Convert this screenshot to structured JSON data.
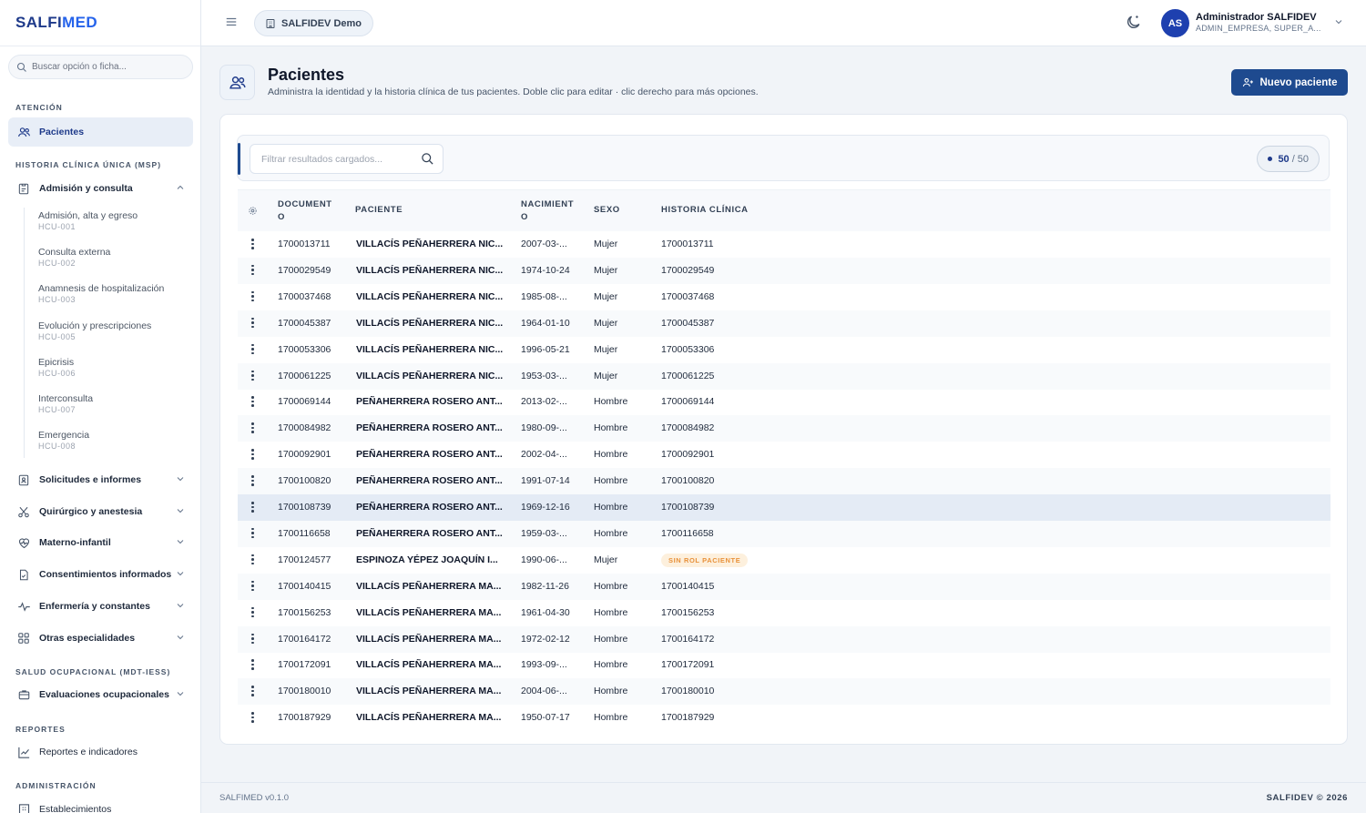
{
  "brand": {
    "part1": "SALFI",
    "part2": "MED"
  },
  "sidebar": {
    "search_placeholder": "Buscar opción o ficha...",
    "section_atencion": "ATENCIÓN",
    "pacientes": "Pacientes",
    "section_hcu": "HISTORIA CLÍNICA ÚNICA (MSP)",
    "admision": "Admisión y consulta",
    "subitems": [
      {
        "title": "Admisión, alta y egreso",
        "code": "HCU-001"
      },
      {
        "title": "Consulta externa",
        "code": "HCU-002"
      },
      {
        "title": "Anamnesis de hospitalización",
        "code": "HCU-003"
      },
      {
        "title": "Evolución y prescripciones",
        "code": "HCU-005"
      },
      {
        "title": "Epicrisis",
        "code": "HCU-006"
      },
      {
        "title": "Interconsulta",
        "code": "HCU-007"
      },
      {
        "title": "Emergencia",
        "code": "HCU-008"
      }
    ],
    "solicitudes": "Solicitudes e informes",
    "quirurgico": "Quirúrgico y anestesia",
    "materno": "Materno-infantil",
    "consentimientos": "Consentimientos informados",
    "enfermeria": "Enfermería y constantes",
    "otras": "Otras especialidades",
    "section_salud": "SALUD OCUPACIONAL (MDT-IESS)",
    "evaluaciones": "Evaluaciones ocupacionales",
    "section_reportes": "REPORTES",
    "reportes": "Reportes e indicadores",
    "section_admin": "ADMINISTRACIÓN",
    "establecimientos": "Establecimientos"
  },
  "topbar": {
    "org": "SALFIDEV Demo",
    "avatar": "AS",
    "user_name": "Administrador SALFIDEV",
    "user_role": "ADMIN_EMPRESA, SUPER_A..."
  },
  "page": {
    "title": "Pacientes",
    "subtitle": "Administra la identidad y la historia clínica de tus pacientes. Doble clic para editar · clic derecho para más opciones.",
    "new_button": "Nuevo paciente"
  },
  "filter": {
    "placeholder": "Filtrar resultados cargados...",
    "count_loaded": "50",
    "count_sep": "/",
    "count_total": "50"
  },
  "table": {
    "headers": {
      "doc1": "DOCUMENT",
      "doc2": "O",
      "paciente": "PACIENTE",
      "nac1": "NACIMIENT",
      "nac2": "O",
      "sexo": "SEXO",
      "historia": "HISTORIA CLÍNICA"
    },
    "rows": [
      {
        "doc": "1700013711",
        "paciente": "VILLACÍS PEÑAHERRERA NIC...",
        "nac": "2007-03-...",
        "sexo": "Mujer",
        "hc": "1700013711"
      },
      {
        "doc": "1700029549",
        "paciente": "VILLACÍS PEÑAHERRERA NIC...",
        "nac": "1974-10-24",
        "sexo": "Mujer",
        "hc": "1700029549"
      },
      {
        "doc": "1700037468",
        "paciente": "VILLACÍS PEÑAHERRERA NIC...",
        "nac": "1985-08-...",
        "sexo": "Mujer",
        "hc": "1700037468"
      },
      {
        "doc": "1700045387",
        "paciente": "VILLACÍS PEÑAHERRERA NIC...",
        "nac": "1964-01-10",
        "sexo": "Mujer",
        "hc": "1700045387"
      },
      {
        "doc": "1700053306",
        "paciente": "VILLACÍS PEÑAHERRERA NIC...",
        "nac": "1996-05-21",
        "sexo": "Mujer",
        "hc": "1700053306"
      },
      {
        "doc": "1700061225",
        "paciente": "VILLACÍS PEÑAHERRERA NIC...",
        "nac": "1953-03-...",
        "sexo": "Mujer",
        "hc": "1700061225"
      },
      {
        "doc": "1700069144",
        "paciente": "PEÑAHERRERA ROSERO ANT...",
        "nac": "2013-02-...",
        "sexo": "Hombre",
        "hc": "1700069144"
      },
      {
        "doc": "1700084982",
        "paciente": "PEÑAHERRERA ROSERO ANT...",
        "nac": "1980-09-...",
        "sexo": "Hombre",
        "hc": "1700084982"
      },
      {
        "doc": "1700092901",
        "paciente": "PEÑAHERRERA ROSERO ANT...",
        "nac": "2002-04-...",
        "sexo": "Hombre",
        "hc": "1700092901"
      },
      {
        "doc": "1700100820",
        "paciente": "PEÑAHERRERA ROSERO ANT...",
        "nac": "1991-07-14",
        "sexo": "Hombre",
        "hc": "1700100820"
      },
      {
        "doc": "1700108739",
        "paciente": "PEÑAHERRERA ROSERO ANT...",
        "nac": "1969-12-16",
        "sexo": "Hombre",
        "hc": "1700108739"
      },
      {
        "doc": "1700116658",
        "paciente": "PEÑAHERRERA ROSERO ANT...",
        "nac": "1959-03-...",
        "sexo": "Hombre",
        "hc": "1700116658"
      },
      {
        "doc": "1700124577",
        "paciente": "ESPINOZA YÉPEZ JOAQUÍN I...",
        "nac": "1990-06-...",
        "sexo": "Mujer",
        "hc": "",
        "badge": "SIN ROL PACIENTE"
      },
      {
        "doc": "1700140415",
        "paciente": "VILLACÍS PEÑAHERRERA MA...",
        "nac": "1982-11-26",
        "sexo": "Hombre",
        "hc": "1700140415"
      },
      {
        "doc": "1700156253",
        "paciente": "VILLACÍS PEÑAHERRERA MA...",
        "nac": "1961-04-30",
        "sexo": "Hombre",
        "hc": "1700156253"
      },
      {
        "doc": "1700164172",
        "paciente": "VILLACÍS PEÑAHERRERA MA...",
        "nac": "1972-02-12",
        "sexo": "Hombre",
        "hc": "1700164172"
      },
      {
        "doc": "1700172091",
        "paciente": "VILLACÍS PEÑAHERRERA MA...",
        "nac": "1993-09-...",
        "sexo": "Hombre",
        "hc": "1700172091"
      },
      {
        "doc": "1700180010",
        "paciente": "VILLACÍS PEÑAHERRERA MA...",
        "nac": "2004-06-...",
        "sexo": "Hombre",
        "hc": "1700180010"
      },
      {
        "doc": "1700187929",
        "paciente": "VILLACÍS PEÑAHERRERA MA...",
        "nac": "1950-07-17",
        "sexo": "Hombre",
        "hc": "1700187929"
      }
    ]
  },
  "footer": {
    "version": "SALFIMED v0.1.0",
    "copyright": "SALFIDEV © 2026"
  },
  "colors": {
    "primary": "#1e4a8f",
    "badge_bg": "#fdf0dd",
    "badge_text": "#e8913a",
    "row_highlight": "#e4ebf5"
  }
}
